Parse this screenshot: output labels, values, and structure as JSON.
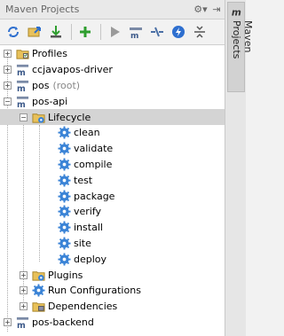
{
  "panel": {
    "title": "Maven Projects"
  },
  "side_tab": {
    "label": "Maven Projects"
  },
  "toolbar": {
    "buttons": [
      "reimport-icon",
      "generate-sources-icon",
      "download-icon",
      "add-icon",
      "run-icon",
      "execute-goal-icon",
      "toggle-offline-icon",
      "skip-tests-icon",
      "collapse-all-icon"
    ]
  },
  "tree": {
    "profiles": "Profiles",
    "ccjavapos": "ccjavapos-driver",
    "pos": "pos",
    "pos_root": "(root)",
    "pos_api": "pos-api",
    "lifecycle": "Lifecycle",
    "goals": [
      "clean",
      "validate",
      "compile",
      "test",
      "package",
      "verify",
      "install",
      "site",
      "deploy"
    ],
    "plugins": "Plugins",
    "run_configurations": "Run Configurations",
    "dependencies": "Dependencies",
    "pos_backend": "pos-backend"
  },
  "colors": {
    "selected_row": "#d4d4d4",
    "gear_blue": "#3a83d6",
    "add_green": "#2f9e2f"
  }
}
